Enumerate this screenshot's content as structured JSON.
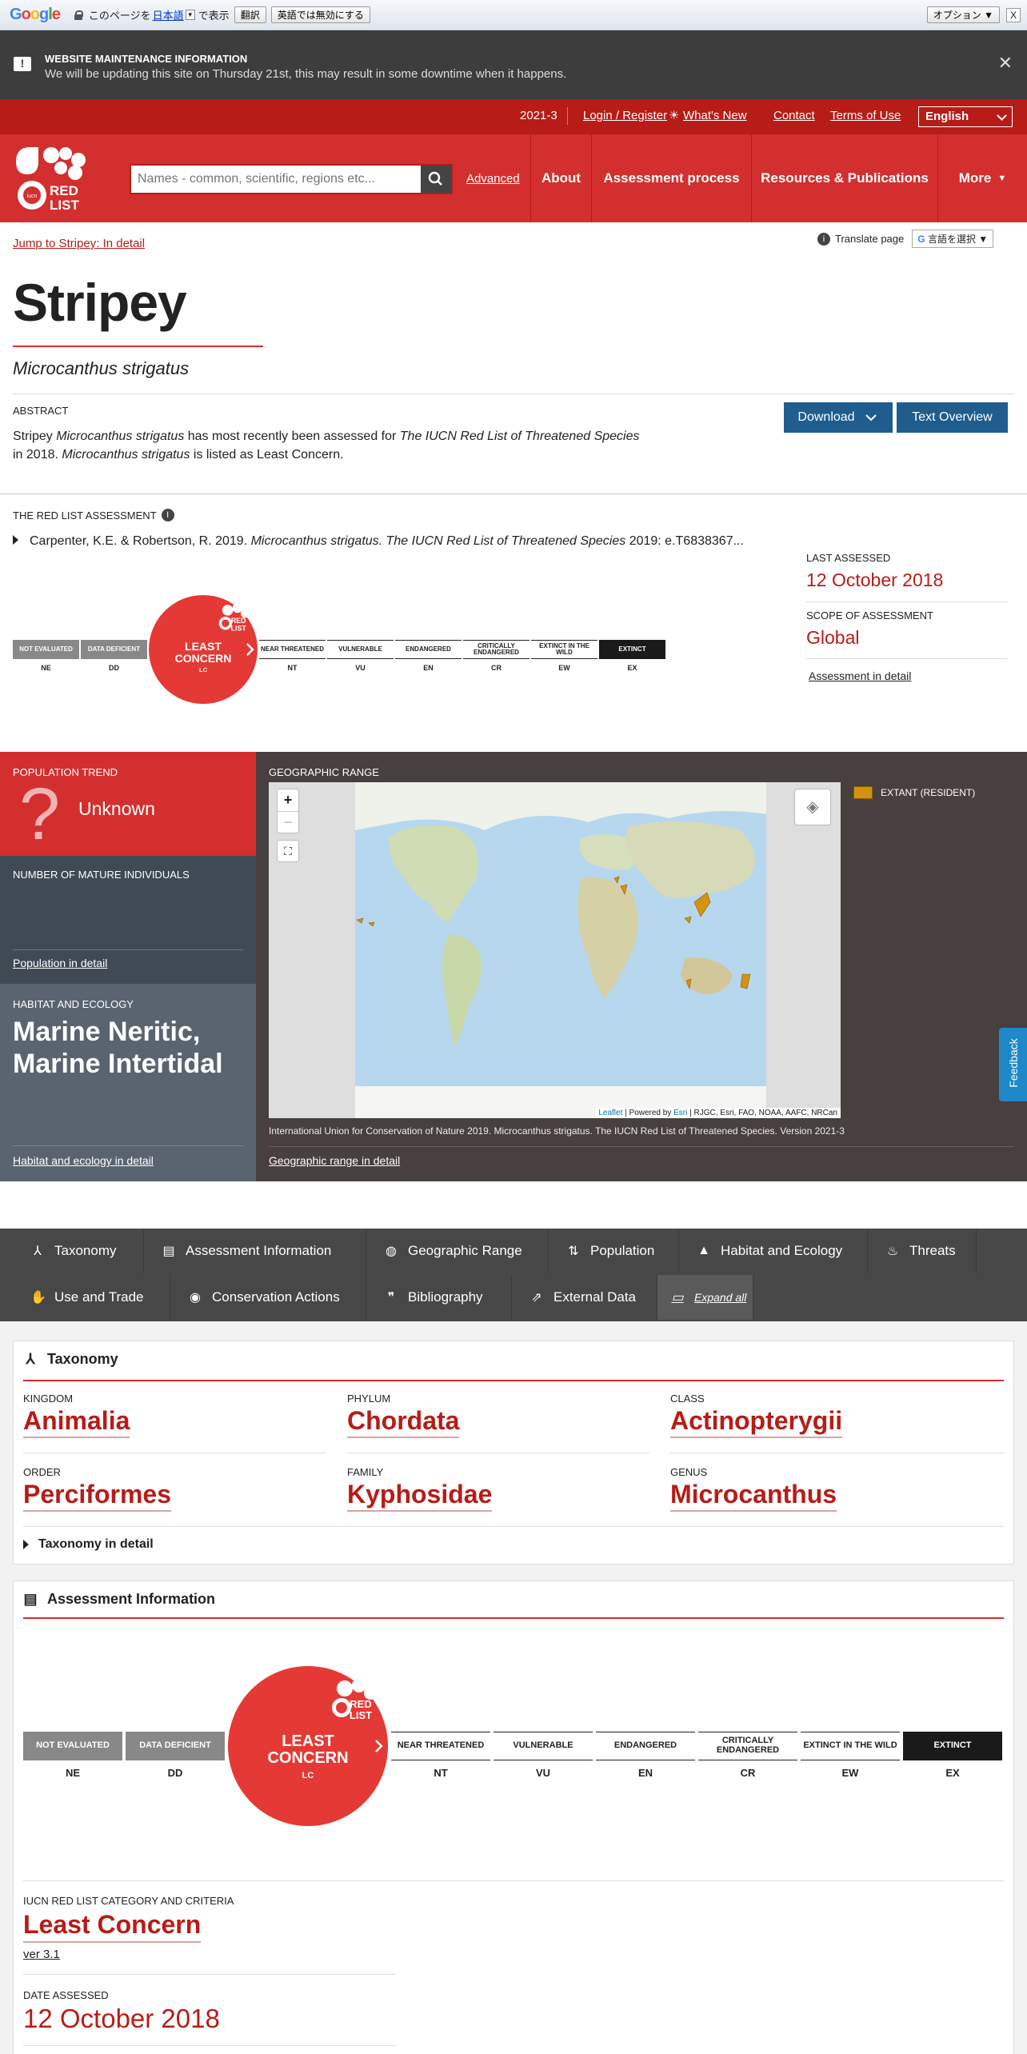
{
  "translate_bar": {
    "prefix": "このページを",
    "language": "日本語",
    "suffix": "で表示",
    "translate_btn": "翻訳",
    "never_btn": "英語では無効にする",
    "options_btn": "オプション ▼",
    "close": "X"
  },
  "maintenance": {
    "title": "WEBSITE MAINTENANCE INFORMATION",
    "body": "We will be updating this site on Thursday 21st, this may result in some downtime when it happens.",
    "close": "✕"
  },
  "topnav": {
    "version": "2021-3",
    "login": "Login / Register",
    "whats_new": "What's New",
    "contact": "Contact",
    "terms": "Terms of Use",
    "language": "English"
  },
  "mainnav": {
    "logo_text": "RED LIST",
    "search_placeholder": "Names - common, scientific, regions etc...",
    "advanced": "Advanced",
    "about": "About",
    "assessment_process": "Assessment process",
    "resources": "Resources & Publications",
    "more": "More"
  },
  "species": {
    "jump": "Jump to Stripey: In detail",
    "translate_label": "Translate page",
    "translate_select": "言語を選択",
    "common_name": "Stripey",
    "scientific_name": "Microcanthus strigatus",
    "abstract_label": "ABSTRACT",
    "abstract_1": "Stripey ",
    "abstract_2": "Microcanthus strigatus",
    "abstract_3": " has most recently been assessed for ",
    "abstract_4": "The IUCN Red List of Threatened Species",
    "abstract_5": " in 2018. ",
    "abstract_6": "Microcanthus strigatus",
    "abstract_7": " is listed as Least Concern.",
    "download": "Download",
    "text_overview": "Text Overview"
  },
  "assessment": {
    "label": "THE RED LIST ASSESSMENT",
    "citation_1": "Carpenter, K.E. & Robertson, R. 2019. ",
    "citation_2": "Microcanthus strigatus. The IUCN Red List of Threatened Species",
    "citation_3": " 2019: e.T6838367...",
    "last_assessed_label": "LAST ASSESSED",
    "last_assessed": "12 October 2018",
    "scope_label": "SCOPE OF ASSESSMENT",
    "scope": "Global",
    "detail_link": "Assessment in detail"
  },
  "scale": {
    "current_index": 2,
    "categories": [
      {
        "label": "NOT EVALUATED",
        "abbr": "NE"
      },
      {
        "label": "DATA DEFICIENT",
        "abbr": "DD"
      },
      {
        "label": "LEAST CONCERN",
        "abbr": "LC"
      },
      {
        "label": "NEAR THREATENED",
        "abbr": "NT"
      },
      {
        "label": "VULNERABLE",
        "abbr": "VU"
      },
      {
        "label": "ENDANGERED",
        "abbr": "EN"
      },
      {
        "label": "CRITICALLY ENDANGERED",
        "abbr": "CR"
      },
      {
        "label": "EXTINCT IN THE WILD",
        "abbr": "EW"
      },
      {
        "label": "EXTINCT",
        "abbr": "EX"
      }
    ],
    "lc_line1": "LEAST",
    "lc_line2": "CONCERN",
    "lc_abbr": "LC"
  },
  "population": {
    "trend_label": "POPULATION TREND",
    "trend_value": "Unknown",
    "mature_label": "NUMBER OF MATURE INDIVIDUALS",
    "detail_link": "Population in detail"
  },
  "habitat": {
    "label": "HABITAT AND ECOLOGY",
    "value": "Marine Neritic, Marine Intertidal",
    "detail_link": "Habitat and ecology in detail"
  },
  "geo": {
    "label": "GEOGRAPHIC RANGE",
    "legend": "EXTANT (RESIDENT)",
    "attribution_leaflet": "Leaflet",
    "attribution_mid": " | Powered by ",
    "attribution_esri": "Esri",
    "attribution_rest": " | RJGC, Esri, FAO, NOAA, AAFC, NRCan",
    "zoom_in": "+",
    "zoom_out": "−",
    "caption": "International Union for Conservation of Nature 2019. Microcanthus strigatus. The IUCN Red List of Threatened Species. Version 2021-3",
    "detail_link": "Geographic range in detail",
    "range_color": "#d4930e"
  },
  "feedback": "Feedback",
  "tabs": [
    {
      "label": "Taxonomy",
      "icon": "taxonomy-icon",
      "glyph": "⅄"
    },
    {
      "label": "Assessment Information",
      "icon": "clipboard-icon",
      "glyph": "▤"
    },
    {
      "label": "Geographic Range",
      "icon": "globe-icon",
      "glyph": "◍"
    },
    {
      "label": "Population",
      "icon": "arrows-icon",
      "glyph": "⇅"
    },
    {
      "label": "Habitat and Ecology",
      "icon": "mountain-icon",
      "glyph": "▲"
    },
    {
      "label": "Threats",
      "icon": "flame-icon",
      "glyph": "♨"
    },
    {
      "label": "Use and Trade",
      "icon": "hand-icon",
      "glyph": "✋"
    },
    {
      "label": "Conservation Actions",
      "icon": "eye-icon",
      "glyph": "◉"
    },
    {
      "label": "Bibliography",
      "icon": "quote-icon",
      "glyph": "❞"
    },
    {
      "label": "External Data",
      "icon": "external-link-icon",
      "glyph": "⇗"
    },
    {
      "label": "Expand all",
      "icon": "expand-icon",
      "glyph": "▭"
    }
  ],
  "taxonomy": {
    "title": "Taxonomy",
    "kingdom_label": "KINGDOM",
    "kingdom": "Animalia",
    "phylum_label": "PHYLUM",
    "phylum": "Chordata",
    "class_label": "CLASS",
    "class": "Actinopterygii",
    "order_label": "ORDER",
    "order": "Perciformes",
    "family_label": "FAMILY",
    "family": "Kyphosidae",
    "genus_label": "GENUS",
    "genus": "Microcanthus",
    "detail": "Taxonomy in detail"
  },
  "assessment_info": {
    "title": "Assessment Information",
    "category_label": "IUCN RED LIST CATEGORY AND CRITERIA",
    "category": "Least Concern",
    "version": "ver 3.1",
    "date_label": "DATE ASSESSED",
    "date": "12 October 2018"
  },
  "colors": {
    "brand_red": "#d32f2f",
    "dark_red": "#b71c17",
    "button_blue": "#1f5d8e"
  }
}
